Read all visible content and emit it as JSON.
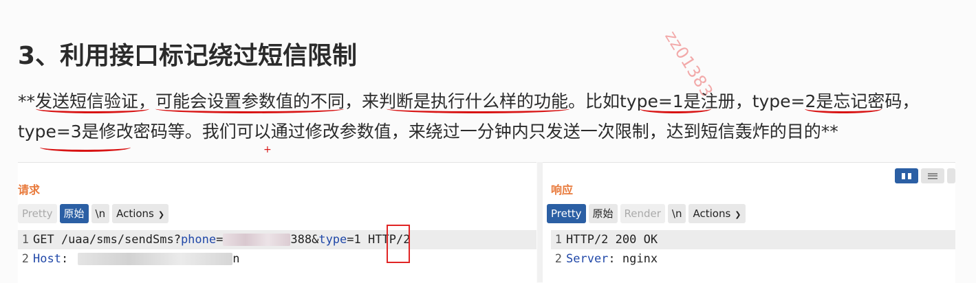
{
  "watermark": "zz01383",
  "heading": "3、利用接口标记绕过短信限制",
  "paragraph": "**发送短信验证，可能会设置参数值的不同，来判断是执行什么样的功能。比如type=1是注册，type=2是忘记密码，type=3是修改密码等。我们可以通过修改参数值，来绕过一分钟内只发送一次限制，达到短信轰炸的目的**",
  "request": {
    "title": "请求",
    "tabs": {
      "pretty": "Pretty",
      "raw": "原始",
      "newline": "\\n",
      "actions": "Actions"
    },
    "line1": {
      "num": "1",
      "prefix": "GET /uaa/sms/sendSms?",
      "param1": "phone",
      "eq1": "=",
      "suffix1": "388&",
      "param2": "type",
      "eq2": "=",
      "value2": "1",
      "tail": " HTTP/2"
    },
    "line2": {
      "num": "2",
      "key": "Host",
      "sep": ":",
      "tail": "n"
    }
  },
  "response": {
    "title": "响应",
    "tabs": {
      "pretty": "Pretty",
      "raw": "原始",
      "render": "Render",
      "newline": "\\n",
      "actions": "Actions"
    },
    "line1": {
      "num": "1",
      "text": "HTTP/2 200 OK"
    },
    "line2": {
      "num": "2",
      "key": "Server",
      "sep": ":",
      "value": " nginx"
    }
  },
  "icons": {
    "chevron": "chevron-down-icon",
    "layout_split": "split-view-icon",
    "layout_rows": "rows-view-icon"
  }
}
